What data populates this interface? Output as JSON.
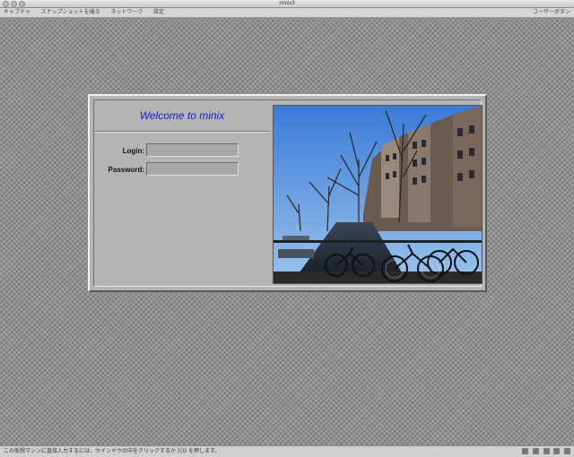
{
  "window": {
    "title": "minix3"
  },
  "toolbar": {
    "items": [
      "キャプチャ",
      "スナップショットを撮る",
      "ネットワーク",
      "設定"
    ],
    "right_text": "ユーザーボタン"
  },
  "login_panel": {
    "welcome_text": "Welcome to minix",
    "login_label": "Login:",
    "login_value": "",
    "password_label": "Password:",
    "password_value": "",
    "welcome_color": "#1a1ad0"
  },
  "statusbar": {
    "message": "この仮想マシンに直接入力するには、ウインドウの中をクリックするか ⌘G を押します。"
  },
  "colors": {
    "panel_bg": "#b4b4b4",
    "desktop_bg": "#909090"
  }
}
